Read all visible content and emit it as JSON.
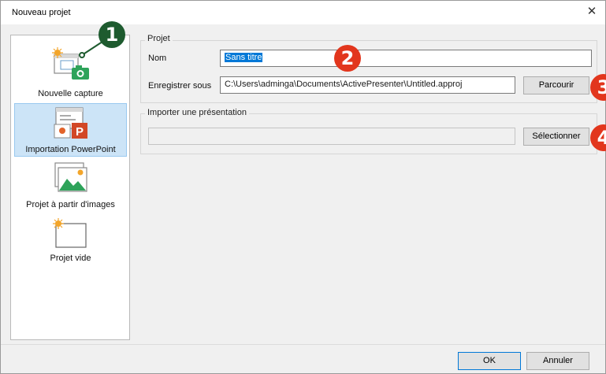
{
  "window": {
    "title": "Nouveau projet",
    "close_glyph": "✕"
  },
  "sidebar": {
    "items": [
      {
        "label": "Nouvelle capture",
        "icon": "screen-capture-icon"
      },
      {
        "label": "Importation PowerPoint",
        "icon": "powerpoint-icon",
        "selected": true
      },
      {
        "label": "Projet à partir d'images",
        "icon": "images-icon"
      },
      {
        "label": "Projet vide",
        "icon": "blank-project-icon"
      }
    ]
  },
  "project": {
    "group_title": "Projet",
    "name_label": "Nom",
    "name_value": "Sans titre",
    "save_label": "Enregistrer sous",
    "save_value": "C:\\Users\\adminga\\Documents\\ActivePresenter\\Untitled.approj",
    "browse_button": "Parcourir"
  },
  "import": {
    "group_title": "Importer une présentation",
    "file_value": "",
    "select_button": "Sélectionner"
  },
  "footer": {
    "ok_button": "OK",
    "cancel_button": "Annuler"
  },
  "callouts": [
    "1",
    "2",
    "3",
    "4"
  ],
  "colors": {
    "callout_red": "#e2361d",
    "callout_green": "#1e5b2f",
    "selection": "#cce4f7",
    "accent": "#0078d7"
  }
}
